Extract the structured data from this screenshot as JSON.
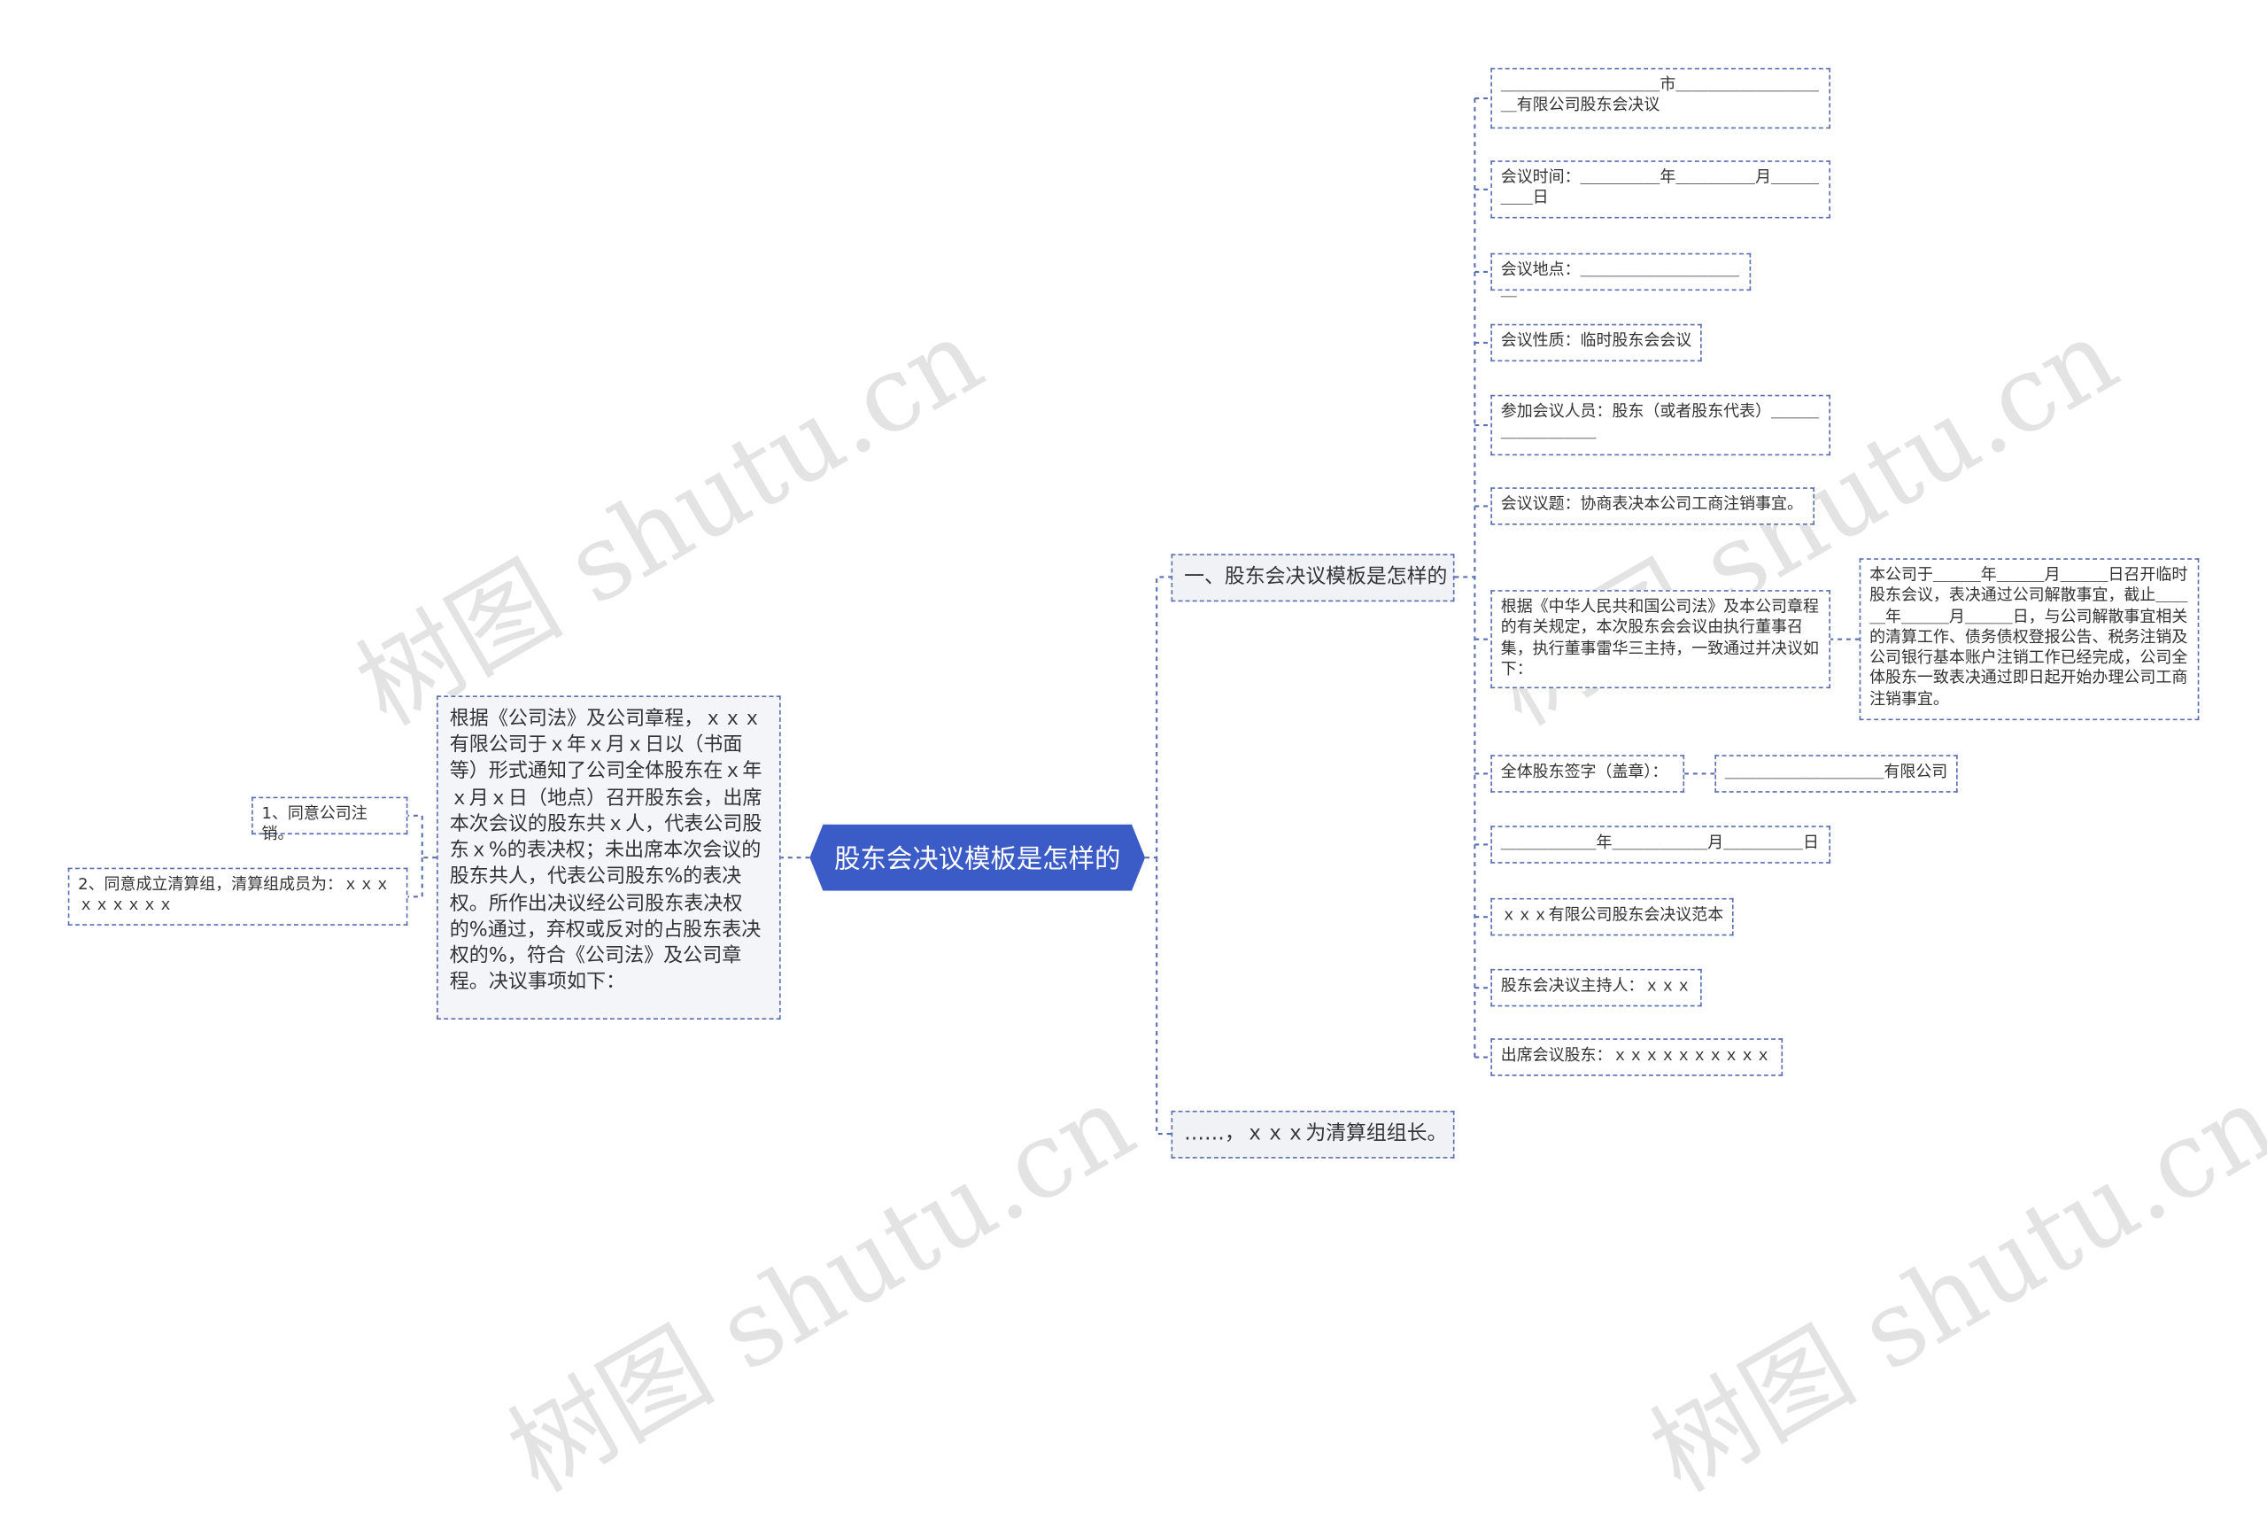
{
  "root": {
    "label": "股东会决议模板是怎样的"
  },
  "left": {
    "main": "根据《公司法》及公司章程，ｘｘｘ有限公司于ｘ年ｘ月ｘ日以（书面等）形式通知了公司全体股东在ｘ年ｘ月ｘ日（地点）召开股东会，出席本次会议的股东共ｘ人，代表公司股东ｘ%的表决权；未出席本次会议的股东共人，代表公司股东%的表决权。所作出决议经公司股东表决权的%通过，弃权或反对的占股东表决权的%，符合《公司法》及公司章程。决议事项如下：",
    "items": [
      "1、同意公司注销。",
      "2、同意成立清算组，清算组成员为：ｘｘｘｘｘｘｘｘｘ"
    ]
  },
  "right": {
    "branch1": "一、股东会决议模板是怎样的",
    "branch2": "……，ｘｘｘ为清算组组长。",
    "items": [
      "＿＿＿＿＿＿＿＿＿＿市＿＿＿＿＿＿＿＿＿＿有限公司股东会决议",
      "会议时间：＿＿＿＿＿年＿＿＿＿＿月＿＿＿＿＿日",
      "会议地点：＿＿＿＿＿＿＿＿＿＿＿",
      "会议性质：临时股东会会议",
      "参加会议人员：股东（或者股东代表）＿＿＿＿＿＿＿＿＿",
      "会议议题：协商表决本公司工商注销事宜。",
      "根据《中华人民共和国公司法》及本公司章程的有关规定，本次股东会会议由执行董事召集，执行董事雷华三主持，一致通过并决议如下：",
      "全体股东签字（盖章）：",
      "＿＿＿＿＿＿年＿＿＿＿＿＿月＿＿＿＿＿日",
      "ｘｘｘ有限公司股东会决议范本",
      "股东会决议主持人：ｘｘｘ",
      "出席会议股东：ｘｘｘｘｘｘｘｘｘｘ"
    ],
    "resolution_detail": "本公司于＿＿＿年＿＿＿月＿＿＿日召开临时股东会议，表决通过公司解散事宜，截止＿＿＿年＿＿＿月＿＿＿日，与公司解散事宜相关的清算工作、债务债权登报公告、税务注销及公司银行基本账户注销工作已经完成，公司全体股东一致表决通过即日起开始办理公司工商注销事宜。",
    "company_sign": "＿＿＿＿＿＿＿＿＿＿有限公司"
  },
  "watermark": "树图 shutu.cn",
  "colors": {
    "root": "#3b5bc6",
    "line": "#5a6fb4"
  }
}
